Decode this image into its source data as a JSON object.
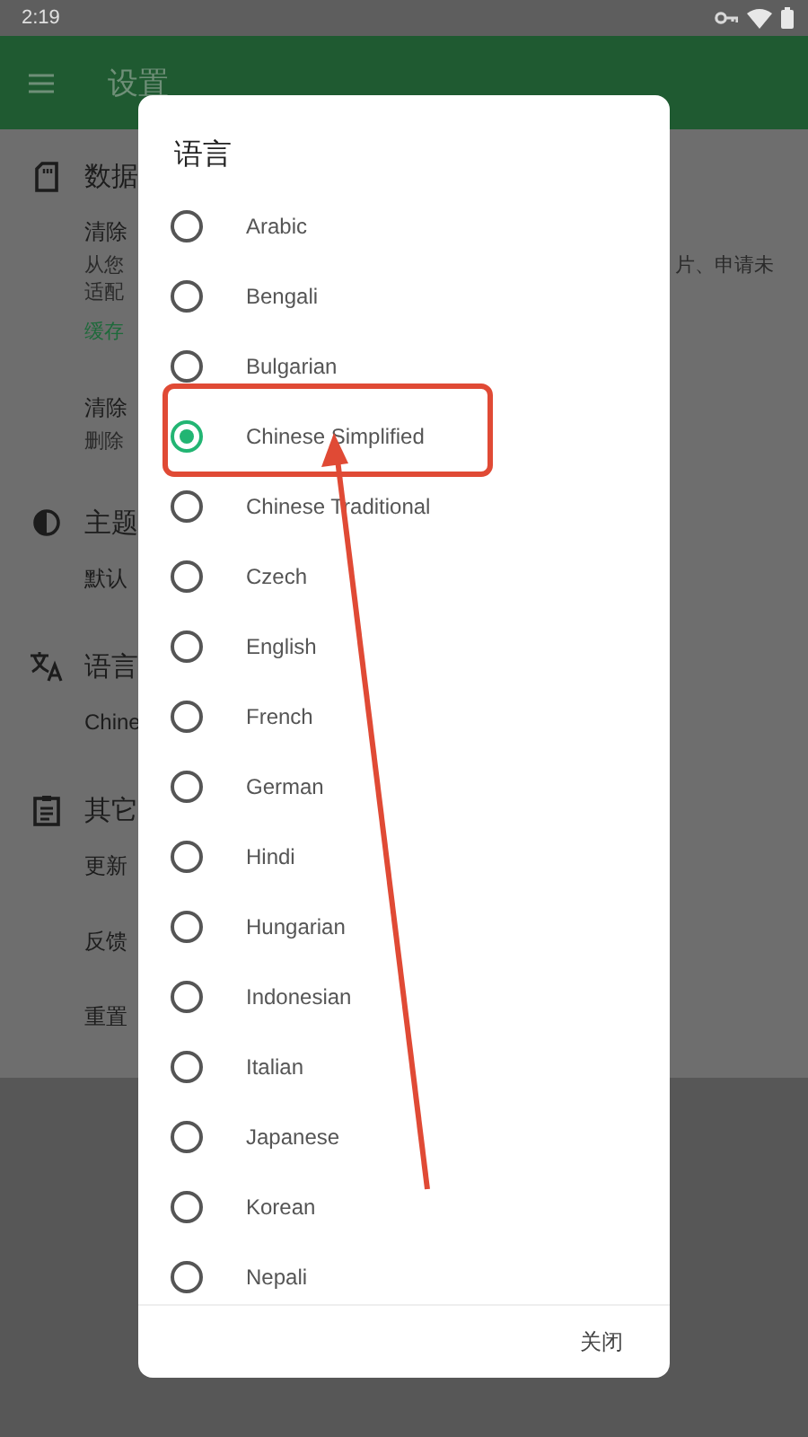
{
  "status_bar": {
    "time": "2:19"
  },
  "app_bar": {
    "title": "设置"
  },
  "settings": [
    {
      "title": "数据",
      "items": [
        {
          "title": "清除",
          "lines": [
            {
              "start": "从您",
              "end": "片、申请未"
            },
            {
              "start": "适配"
            }
          ],
          "note": "缓存"
        },
        {
          "title": "清除",
          "lines": [
            {
              "start": "删除"
            }
          ]
        }
      ]
    },
    {
      "title": "主题",
      "items": [
        {
          "title": "默认"
        }
      ]
    },
    {
      "title": "语言",
      "items": [
        {
          "title": "Chine"
        }
      ]
    },
    {
      "title": "其它",
      "items": [
        {
          "title": "更新"
        },
        {
          "title": "反馈"
        },
        {
          "title": "重置"
        }
      ]
    }
  ],
  "dialog": {
    "title": "语言",
    "options": [
      {
        "label": "Arabic",
        "selected": false
      },
      {
        "label": "Bengali",
        "selected": false
      },
      {
        "label": "Bulgarian",
        "selected": false
      },
      {
        "label": "Chinese Simplified",
        "selected": true
      },
      {
        "label": "Chinese Traditional",
        "selected": false
      },
      {
        "label": "Czech",
        "selected": false
      },
      {
        "label": "English",
        "selected": false
      },
      {
        "label": "French",
        "selected": false
      },
      {
        "label": "German",
        "selected": false
      },
      {
        "label": "Hindi",
        "selected": false
      },
      {
        "label": "Hungarian",
        "selected": false
      },
      {
        "label": "Indonesian",
        "selected": false
      },
      {
        "label": "Italian",
        "selected": false
      },
      {
        "label": "Japanese",
        "selected": false
      },
      {
        "label": "Korean",
        "selected": false
      },
      {
        "label": "Nepali",
        "selected": false
      }
    ],
    "button": "关闭"
  }
}
